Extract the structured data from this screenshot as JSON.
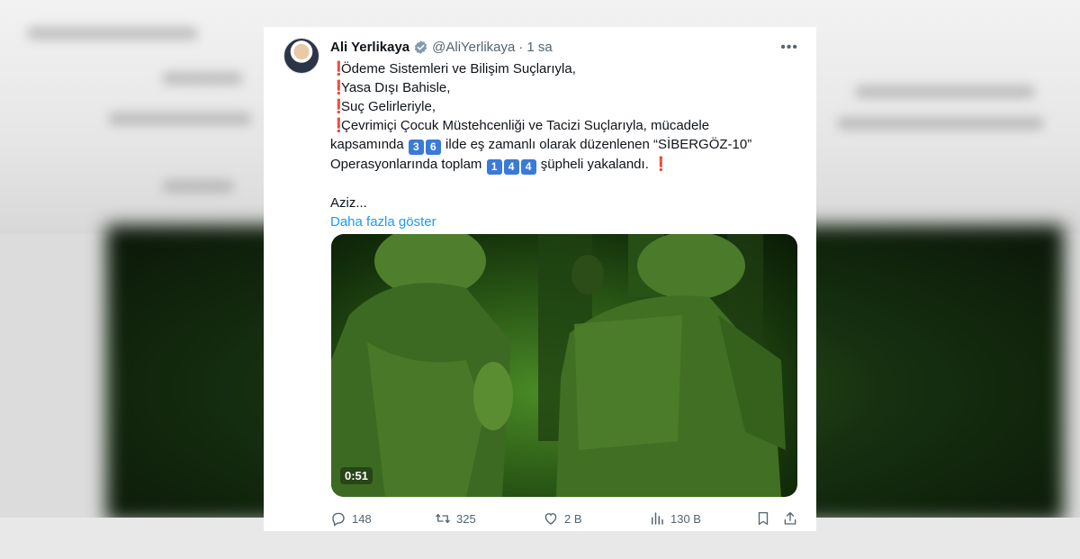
{
  "author": {
    "name": "Ali Yerlikaya",
    "handle": "@AliYerlikaya",
    "separator": "·",
    "time": "1 sa"
  },
  "tweet": {
    "lines": [
      "Ödeme Sistemleri ve Bilişim Suçlarıyla,",
      "Yasa Dışı Bahisle,",
      "Suç Gelirleriyle,",
      "Çevrimiçi Çocuk Müstehcenliği ve Tacizi Suçlarıyla, mücadele"
    ],
    "line5_before": "kapsamında ",
    "province_digits": [
      "3",
      "6"
    ],
    "line5_after": " ilde eş zamanlı olarak düzenlenen “SİBERGÖZ-10”",
    "line6_before": "Operasyonlarında toplam ",
    "suspect_digits": [
      "1",
      "4",
      "4"
    ],
    "line6_after": " şüpheli yakalandı. ",
    "excl": "❗",
    "truncated": "Aziz...",
    "show_more": "Daha fazla göster"
  },
  "video": {
    "duration": "0:51"
  },
  "actions": {
    "replies": "148",
    "retweets": "325",
    "likes": "2 B",
    "views": "130 B"
  },
  "colors": {
    "accent": "#1d9bf0",
    "text": "#0f1419",
    "muted": "#536471",
    "keycap": "#3a7ad8",
    "exclamation": "#e0245e"
  }
}
